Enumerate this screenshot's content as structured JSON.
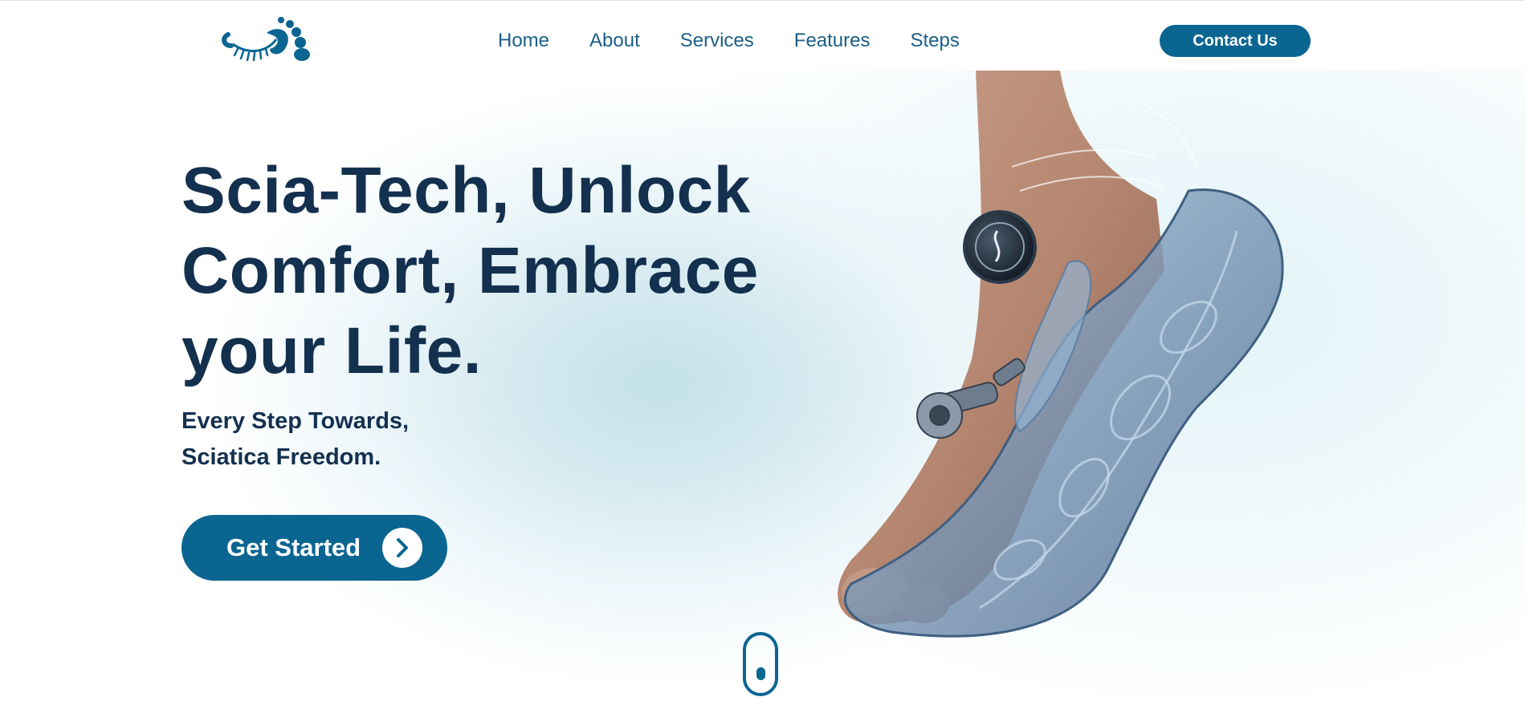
{
  "brand": {
    "logo": "footprint-spine-logo-icon",
    "accent_color": "#0b6591",
    "title_color": "#14304f"
  },
  "nav": {
    "items": [
      {
        "label": "Home"
      },
      {
        "label": "About"
      },
      {
        "label": "Services"
      },
      {
        "label": "Features"
      },
      {
        "label": "Steps"
      }
    ],
    "contact_label": "Contact Us"
  },
  "hero": {
    "title_lines": [
      "Scia-Tech, Unlock",
      "Comfort, Embrace",
      "your Life."
    ],
    "subtitle_lines": [
      "Every Step Towards,",
      "Sciatica Freedom."
    ],
    "cta_label": "Get Started",
    "cta_icon": "chevron-right-icon",
    "scroll_icon": "mouse-scroll-icon",
    "image": "robotic-foot-insole-image"
  }
}
